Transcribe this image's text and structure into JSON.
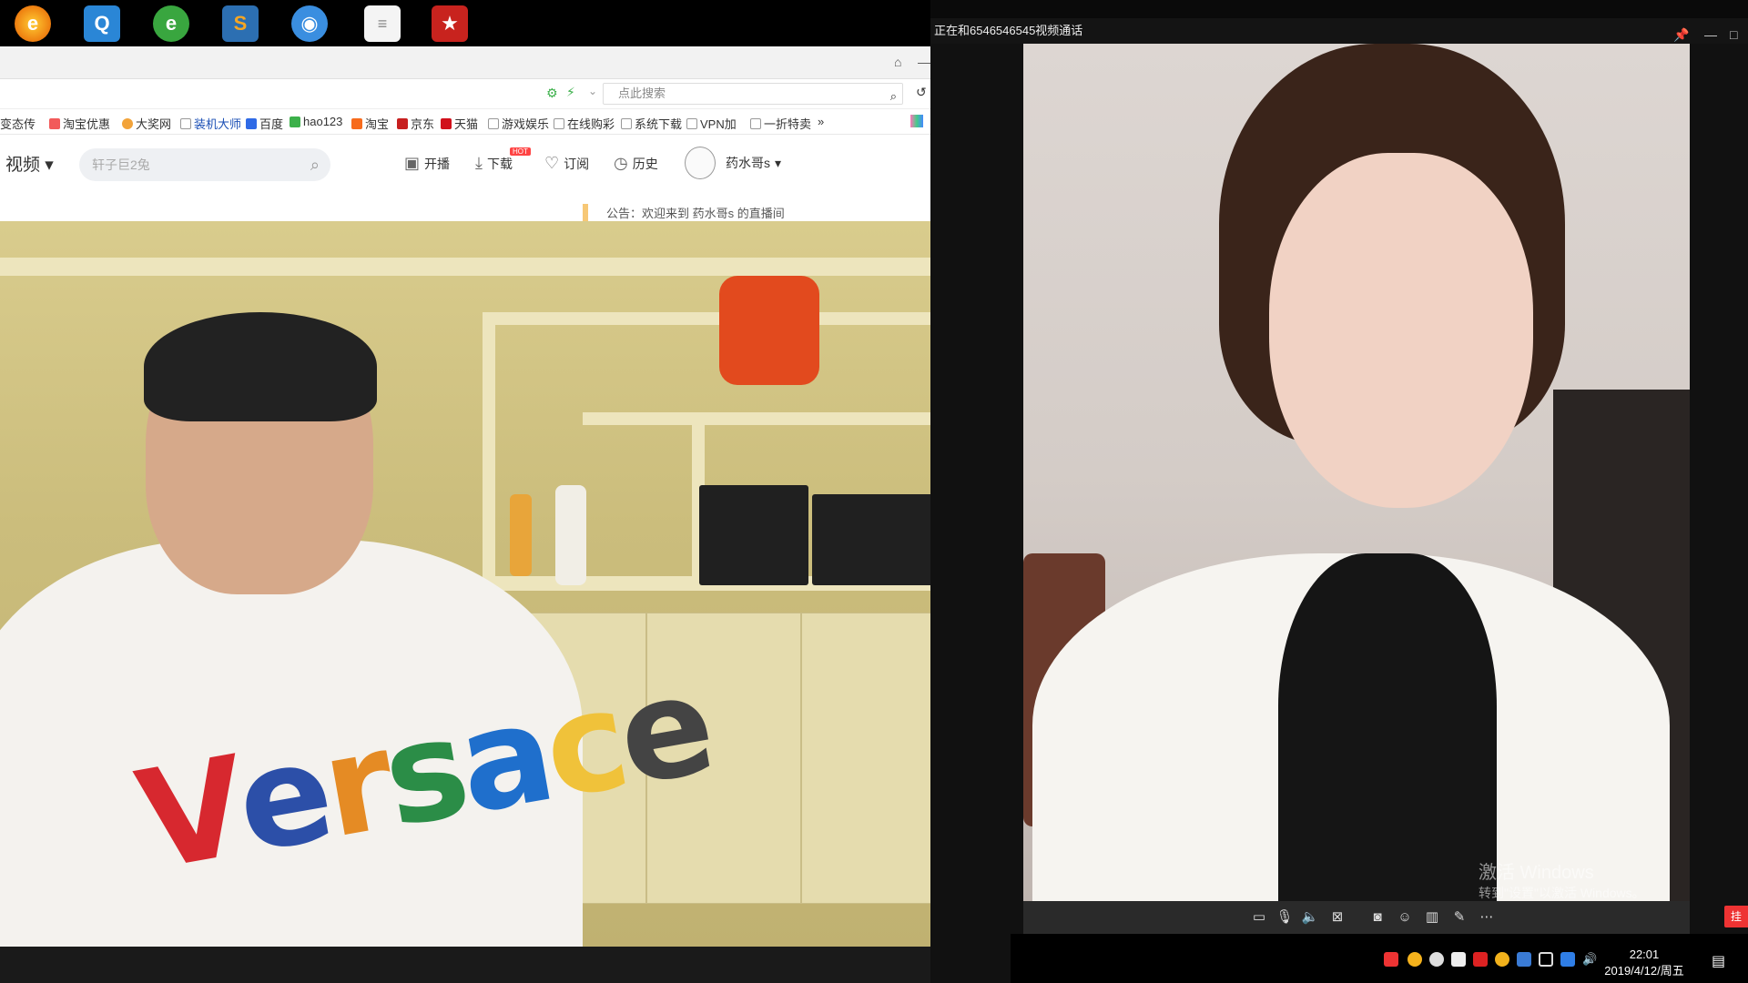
{
  "desktop": {
    "icons": [
      "browser-icon",
      "qq-icon",
      "ie-icon",
      "sogou-icon",
      "network-icon",
      "notepad-icon",
      "game-icon"
    ]
  },
  "browser": {
    "search_placeholder": "点此搜索",
    "bookmarks": [
      "变态传",
      "淘宝优惠",
      "大奖网",
      "装机大师",
      "百度",
      "hao123",
      "淘宝",
      "京东",
      "天猫",
      "游戏娱乐",
      "在线购彩",
      "系统下载",
      "VPN加",
      "一折特卖",
      "»"
    ],
    "site": {
      "section": "视频",
      "search_placeholder": "轩子巨2兔",
      "nav": [
        {
          "label": "开播",
          "icon": "camera-icon"
        },
        {
          "label": "下载",
          "icon": "download-icon",
          "badge": "HOT"
        },
        {
          "label": "订阅",
          "icon": "heart-icon"
        },
        {
          "label": "历史",
          "icon": "clock-icon"
        }
      ],
      "username": "药水哥s"
    },
    "notice": "公告：欢迎来到 药水哥s 的直播间"
  },
  "streamer": {
    "shirt_text": [
      "V",
      "e",
      "r",
      "s",
      "a",
      "c",
      "e"
    ]
  },
  "call": {
    "title": "正在和6546546545视频通话",
    "watermark_line1": "激活 Windows",
    "watermark_line2": "转到\"设置\"以激活 Windows。",
    "hangup_label": "挂"
  },
  "taskbar": {
    "time": "22:01",
    "date": "2019/4/12/周五"
  }
}
